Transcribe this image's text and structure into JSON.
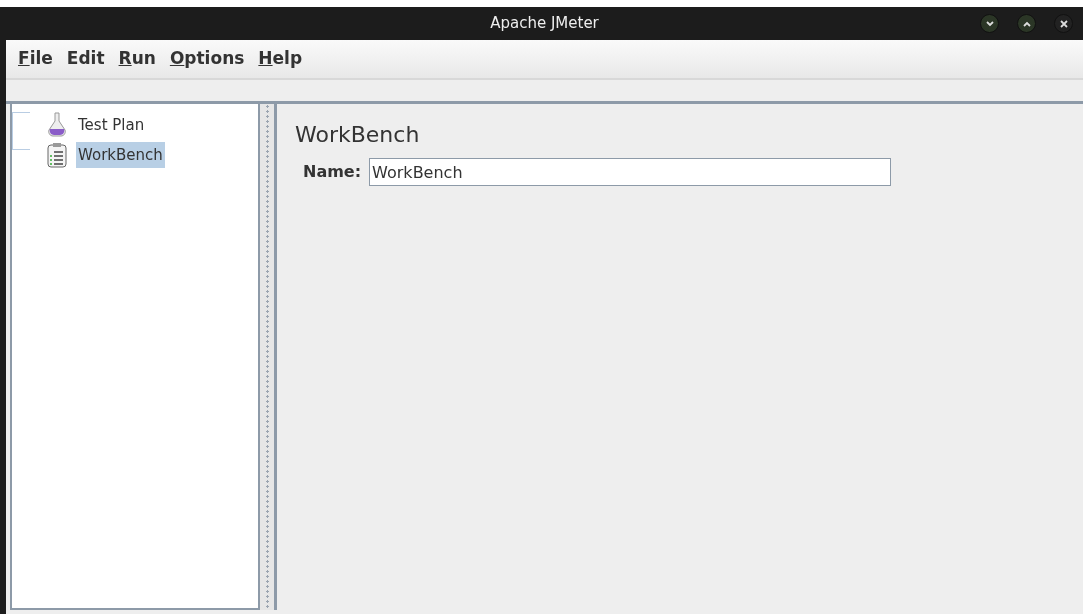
{
  "window": {
    "title": "Apache JMeter",
    "controls": [
      {
        "kind": "minimize"
      },
      {
        "kind": "maximize"
      },
      {
        "kind": "close"
      }
    ]
  },
  "menu": [
    {
      "label": "File",
      "mnemonic": true
    },
    {
      "label": "Edit",
      "mnemonic": false
    },
    {
      "label": "Run",
      "mnemonic": true
    },
    {
      "label": "Options",
      "mnemonic": true
    },
    {
      "label": "Help",
      "mnemonic": true
    }
  ],
  "tree": [
    {
      "label": "Test Plan",
      "kind": "plan",
      "selected": false
    },
    {
      "label": "WorkBench",
      "kind": "workbench",
      "selected": true
    }
  ],
  "panel": {
    "title": "WorkBench",
    "name_label": "Name:",
    "name_value": "WorkBench"
  }
}
